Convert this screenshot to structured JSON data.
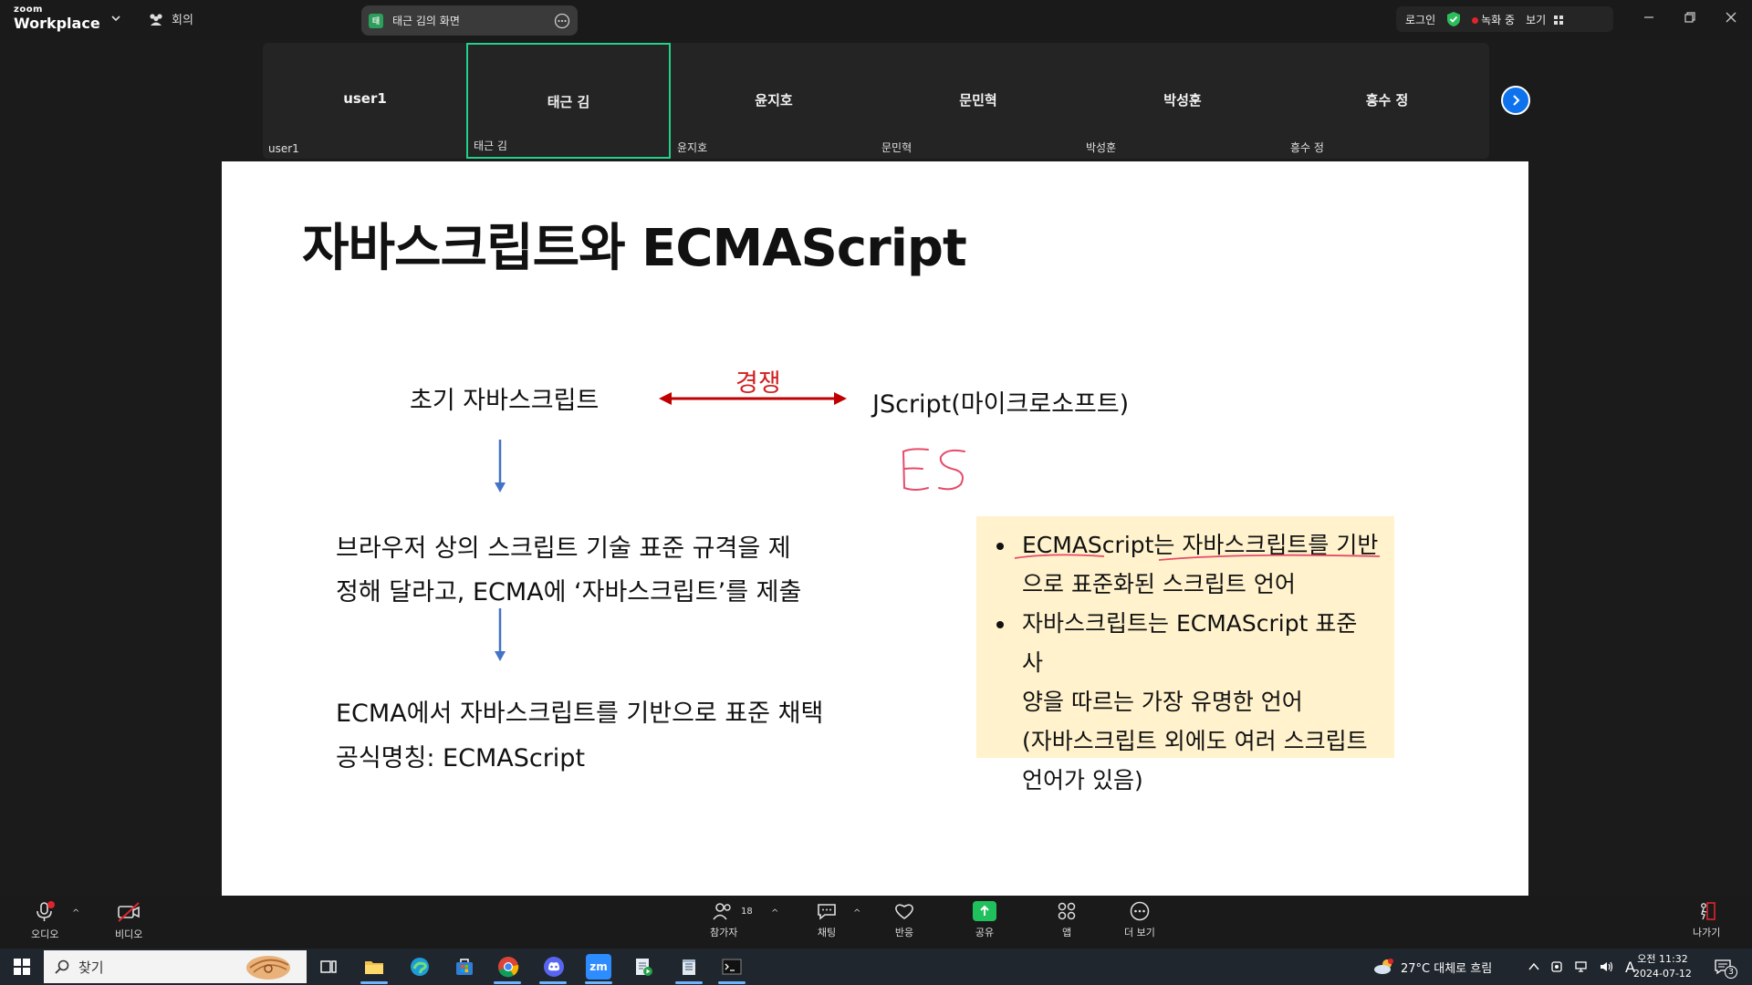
{
  "topbar": {
    "logo_small": "zoom",
    "logo_main": "Workplace",
    "meeting_label": "회의",
    "share_badge": "태",
    "share_title": "태근 김의 화면",
    "login": "로그인",
    "recording": "녹화 중",
    "view": "보기"
  },
  "participants": [
    {
      "name": "user1",
      "label": "user1",
      "active": false
    },
    {
      "name": "태근 김",
      "label": "태근 김",
      "active": true
    },
    {
      "name": "윤지호",
      "label": "윤지호",
      "active": false
    },
    {
      "name": "문민혁",
      "label": "문민혁",
      "active": false
    },
    {
      "name": "박성훈",
      "label": "박성훈",
      "active": false
    },
    {
      "name": "흥수 정",
      "label": "흥수 정",
      "active": false
    }
  ],
  "slide": {
    "title": "자바스크립트와 ECMAScript",
    "early_js": "초기 자바스크립트",
    "competition": "경쟁",
    "jscript": "JScript(마이크로소프트)",
    "para1_line1": "브라우저 상의 스크립트 기술 표준 규격을 제",
    "para1_line2": "정해 달라고, ECMA에 ‘자바스크립트’를 제출",
    "para2_line1": "ECMA에서 자바스크립트를 기반으로 표준 채택",
    "para2_line2": "공식명칭: ECMAScript",
    "note_bullet1_line1": "ECMAScript는 자바스크립트를 기반",
    "note_bullet1_line2": "으로 표준화된 스크립트 언어",
    "note_bullet2_line1": "자바스크립트는 ECMAScript 표준 사",
    "note_bullet2_line2": "양을 따르는 가장 유명한 언어",
    "note_bullet2_line3": "(자바스크립트 외에도 여러 스크립트",
    "note_bullet2_line4": "언어가 있음)"
  },
  "toolbar": {
    "audio": "오디오",
    "video": "비디오",
    "participants": "참가자",
    "participants_count": "18",
    "chat": "채팅",
    "reactions": "반응",
    "share": "공유",
    "apps": "앱",
    "more": "더 보기",
    "leave": "나가기"
  },
  "taskbar": {
    "search_placeholder": "찾기",
    "weather": "27°C 대체로 흐림",
    "ime": "A",
    "time": "오전 11:32",
    "date": "2024-07-12",
    "notification_count": "3",
    "zoom_label": "zm"
  },
  "colors": {
    "accent_green": "#23d18b",
    "zoom_blue": "#0e72ed",
    "competition_red": "#d12020",
    "arrow_blue": "#4472c4",
    "note_bg": "#fff2cc"
  }
}
